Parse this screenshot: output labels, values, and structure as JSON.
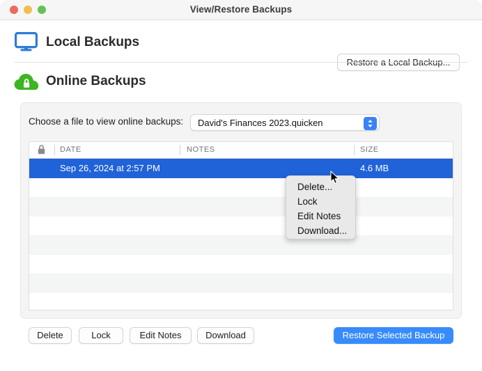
{
  "window": {
    "title": "View/Restore Backups",
    "traffic_lights": [
      "close",
      "minimize",
      "maximize"
    ],
    "colors": {
      "close": "#ed6a5e",
      "minimize": "#f5bd4f",
      "maximize": "#61c454",
      "selection_blue": "#2062d8",
      "primary_blue": "#388bfd",
      "monitor_icon_blue": "#2e7cd6",
      "cloud_icon_green": "#3cb521"
    }
  },
  "local_section": {
    "icon": "monitor-icon",
    "title": "Local Backups",
    "restore_button": "Restore a Local Backup..."
  },
  "online_section": {
    "icon": "cloud-lock-icon",
    "title": "Online Backups"
  },
  "file_chooser": {
    "label": "Choose a file to view online backups:",
    "selected_file": "David's Finances 2023.quicken",
    "options": [
      "David's Finances 2023.quicken"
    ]
  },
  "table": {
    "columns": [
      "",
      "DATE",
      "NOTES",
      "SIZE"
    ],
    "lock_column_icon": "lock-icon",
    "rows": [
      {
        "lock": "",
        "date": "Sep 26, 2024 at 2:57 PM",
        "notes": "",
        "size": "4.6 MB",
        "selected": true
      },
      {
        "lock": "",
        "date": "",
        "notes": "",
        "size": "",
        "selected": false
      },
      {
        "lock": "",
        "date": "",
        "notes": "",
        "size": "",
        "selected": false
      },
      {
        "lock": "",
        "date": "",
        "notes": "",
        "size": "",
        "selected": false
      },
      {
        "lock": "",
        "date": "",
        "notes": "",
        "size": "",
        "selected": false
      },
      {
        "lock": "",
        "date": "",
        "notes": "",
        "size": "",
        "selected": false
      },
      {
        "lock": "",
        "date": "",
        "notes": "",
        "size": "",
        "selected": false
      },
      {
        "lock": "",
        "date": "",
        "notes": "",
        "size": "",
        "selected": false
      }
    ]
  },
  "context_menu": {
    "items": [
      "Delete...",
      "Lock",
      "Edit Notes",
      "Download..."
    ]
  },
  "toolbar": {
    "delete_label": "Delete",
    "lock_label": "Lock",
    "edit_notes_label": "Edit Notes",
    "download_label": "Download",
    "restore_selected_label": "Restore Selected Backup"
  }
}
